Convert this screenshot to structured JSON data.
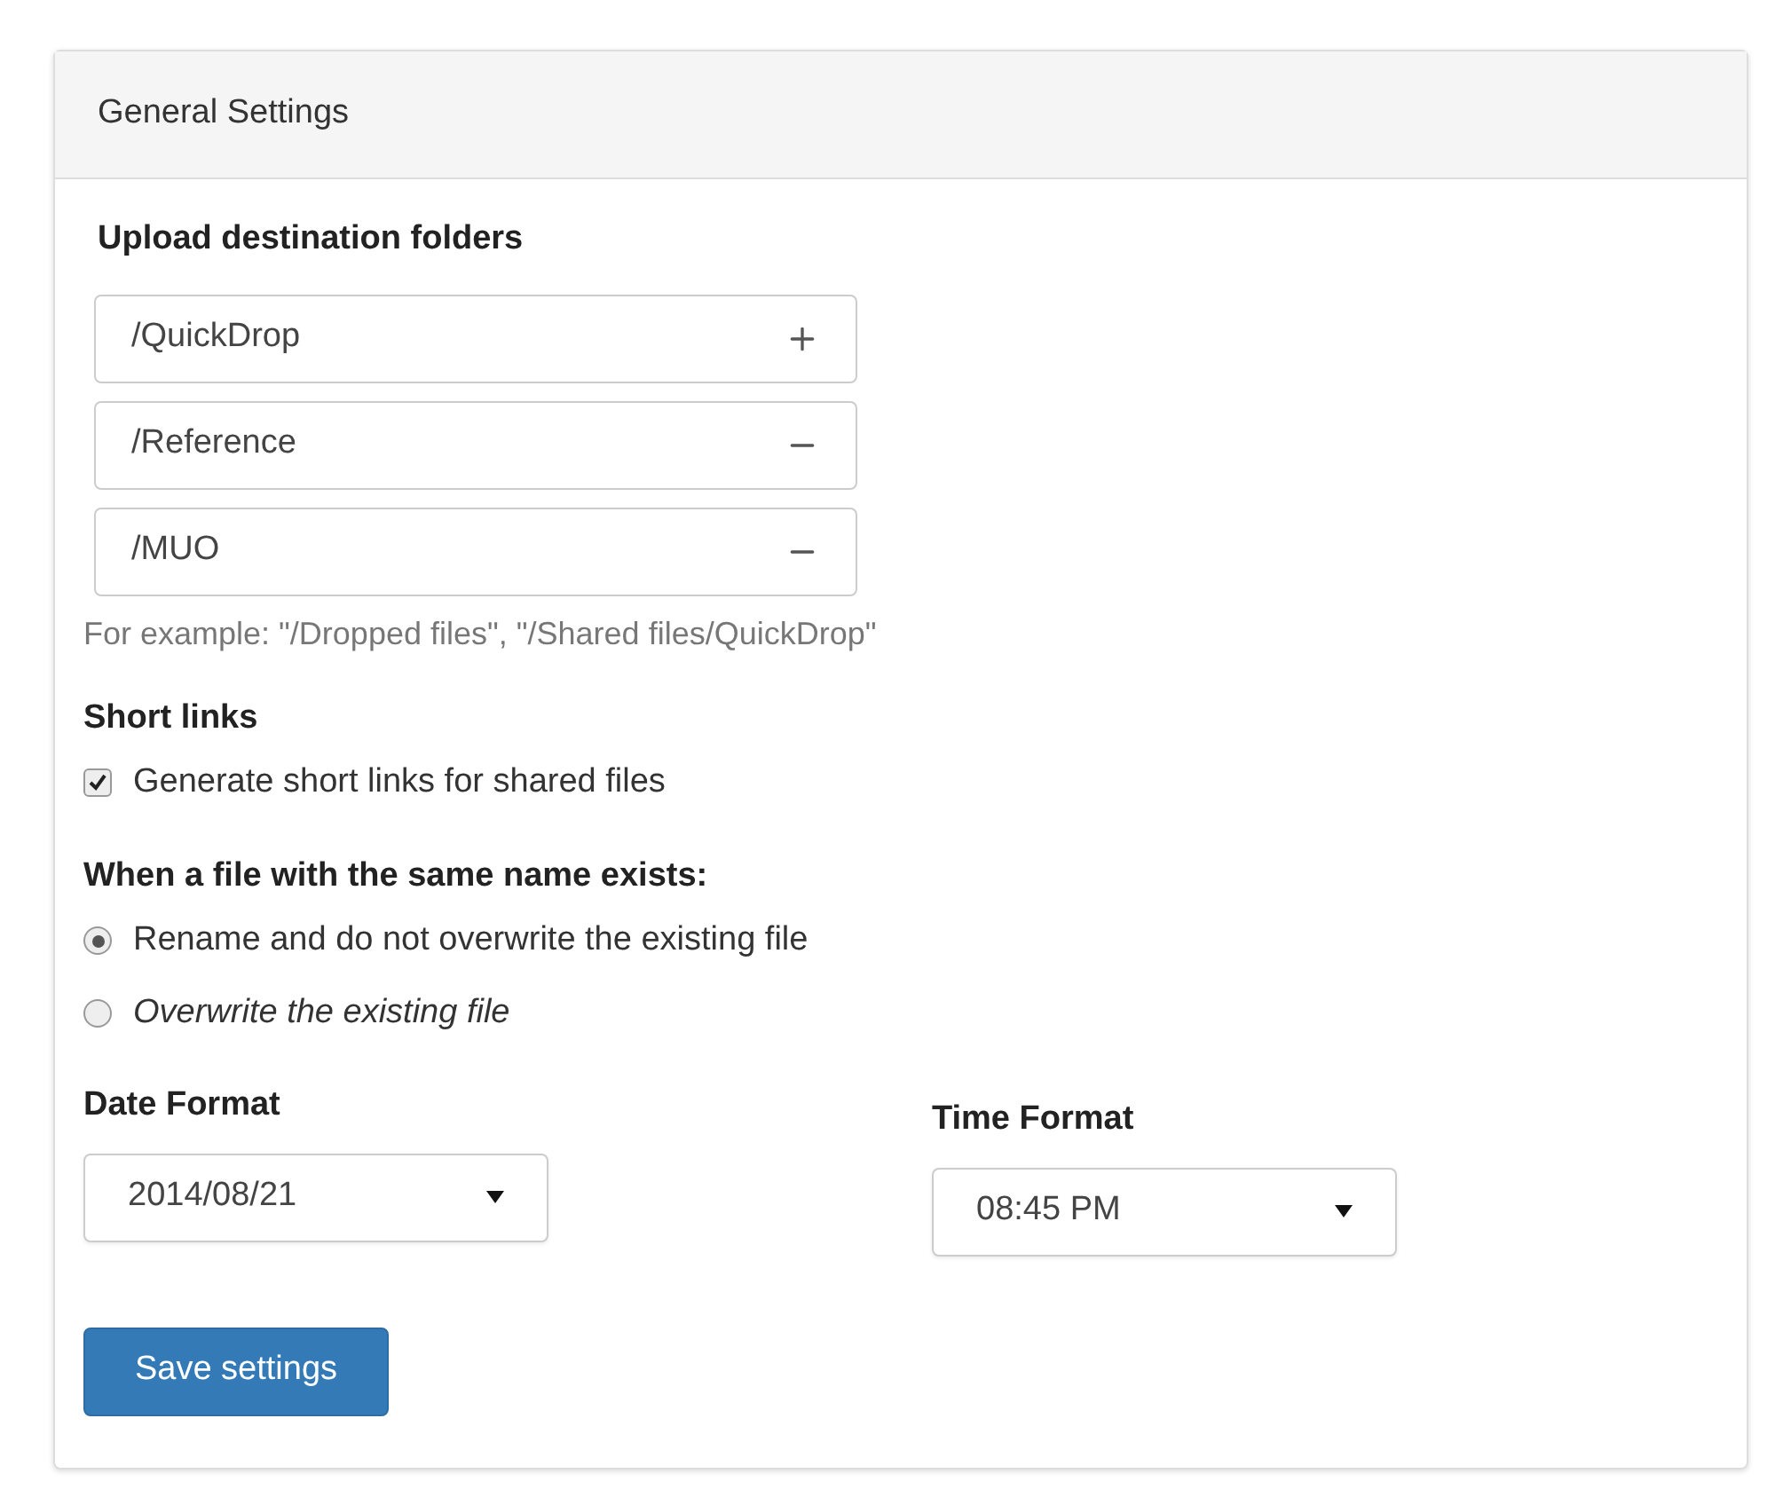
{
  "panel": {
    "title": "General Settings"
  },
  "upload": {
    "label": "Upload destination folders",
    "folders": [
      {
        "value": "/QuickDrop",
        "kind": "add"
      },
      {
        "value": "/Reference",
        "kind": "remove"
      },
      {
        "value": "/MUO",
        "kind": "remove"
      }
    ],
    "help": "For example: \"/Dropped files\", \"/Shared files/QuickDrop\""
  },
  "short_links": {
    "label": "Short links",
    "option": {
      "label": "Generate short links for shared files",
      "checked": true
    }
  },
  "conflict": {
    "label": "When a file with the same name exists:",
    "options": [
      {
        "label": "Rename and do not overwrite the existing file",
        "selected": true
      },
      {
        "label": "Overwrite the existing file",
        "selected": false
      }
    ]
  },
  "date_format": {
    "label": "Date Format",
    "value": "2014/08/21"
  },
  "time_format": {
    "label": "Time Format",
    "value": "08:45 PM"
  },
  "save_button": "Save settings"
}
